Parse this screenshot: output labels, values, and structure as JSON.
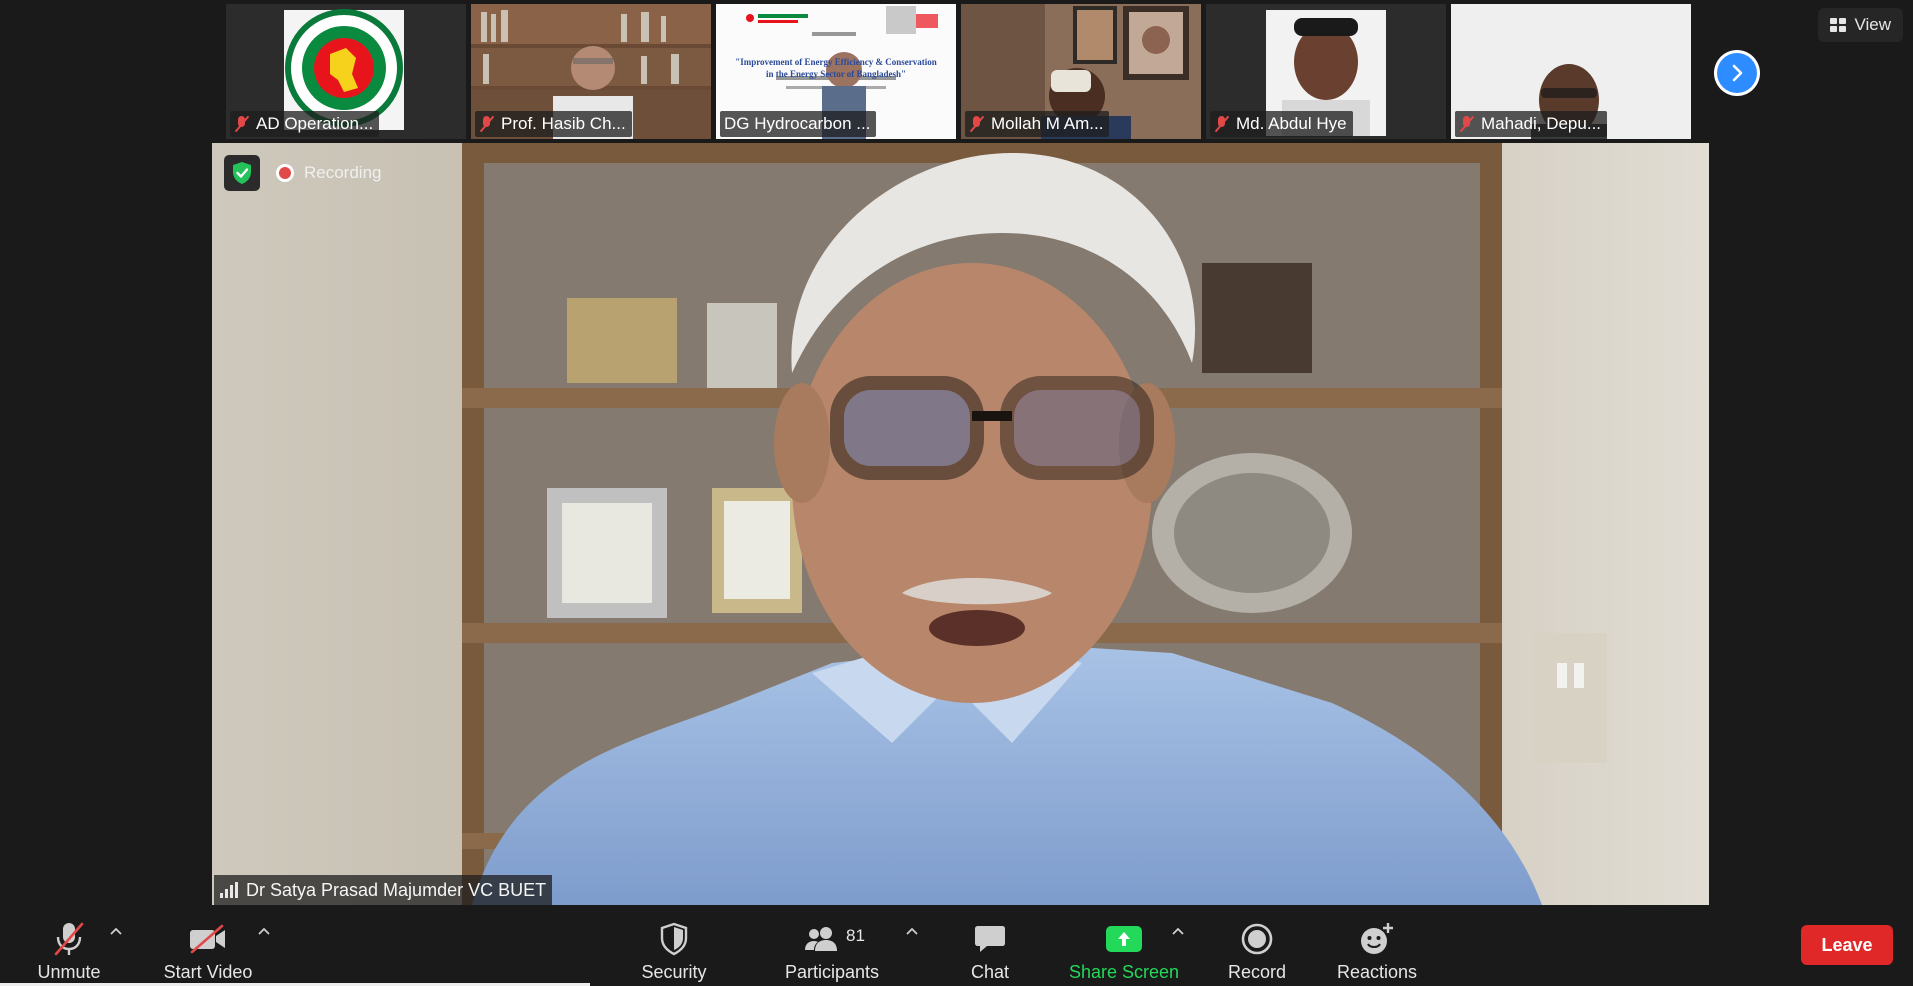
{
  "gallery": [
    {
      "name": "AD Operation...",
      "muted": true
    },
    {
      "name": "Prof. Hasib Ch...",
      "muted": true
    },
    {
      "name": "DG Hydrocarbon ...",
      "muted": false
    },
    {
      "name": "Mollah M Am...",
      "muted": true
    },
    {
      "name": "Md. Abdul Hye",
      "muted": true
    },
    {
      "name": "Mahadi, Depu...",
      "muted": true
    }
  ],
  "slide": {
    "line1": "\"Improvement of Energy Efficiency & Conservation",
    "line2": "in the Energy Sector of Bangladesh\""
  },
  "view_label": "View",
  "recording_label": "Recording",
  "speaker_name": "Dr Satya Prasad Majumder VC BUET",
  "toolbar": {
    "unmute": "Unmute",
    "start_video": "Start Video",
    "security": "Security",
    "participants": "Participants",
    "participant_count": "81",
    "chat": "Chat",
    "share_screen": "Share Screen",
    "record": "Record",
    "reactions": "Reactions",
    "leave": "Leave"
  },
  "colors": {
    "accent_blue": "#2d8cff",
    "share_green": "#23d959",
    "leave_red": "#e02828",
    "muted_red": "#e24848"
  },
  "icons": [
    "mic-muted-icon",
    "video-off-icon",
    "shield-icon",
    "participants-icon",
    "chat-icon",
    "share-screen-icon",
    "record-icon",
    "reactions-icon",
    "grid-view-icon",
    "chevron-right-icon"
  ]
}
